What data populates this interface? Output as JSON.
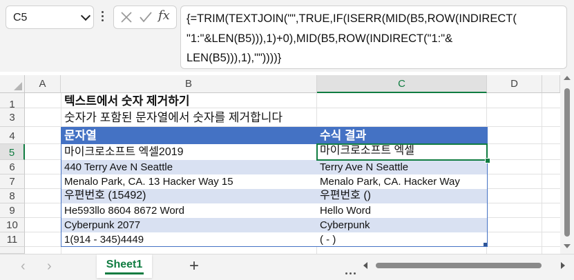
{
  "name_box": {
    "value": "C5"
  },
  "formula_bar": {
    "fx_label": "fx",
    "formula_lines": [
      "{=TRIM(TEXTJOIN(\"\",TRUE,IF(ISERR(MID(B5,ROW(INDIRECT(",
      "\"1:\"&LEN(B5))),1)+0),MID(B5,ROW(INDIRECT(\"1:\"&",
      "LEN(B5))),1),\"\"))))}"
    ]
  },
  "columns": [
    "A",
    "B",
    "C",
    "D"
  ],
  "active_column": "C",
  "rows": [
    "1",
    "3",
    "4",
    "5",
    "6",
    "7",
    "8",
    "9",
    "10",
    "11"
  ],
  "active_row": "5",
  "sheet": {
    "title": "텍스트에서 숫자 제거하기",
    "subtitle": "숫자가 포함된 문자열에서 숫자를 제거합니다",
    "table": {
      "headers": [
        "문자열",
        "수식 결과"
      ],
      "rows": [
        [
          "마이크로소프트 엑셀2019",
          "마이크로소프트 엑셀"
        ],
        [
          "440 Terry Ave N Seattle",
          "Terry Ave N Seattle"
        ],
        [
          "Menalo Park, CA. 13 Hacker Way 15",
          "Menalo Park, CA. Hacker Way"
        ],
        [
          "우편번호 (15492)",
          "우편번호 ()"
        ],
        [
          "He593llo 8604 8672 Word",
          "Hello Word"
        ],
        [
          "Cyberpunk 2077",
          "Cyberpunk"
        ],
        [
          "1(914 - 345)4449",
          "( - )"
        ]
      ]
    },
    "header_color": "#4472c4",
    "band_color": "#d9e1f2"
  },
  "tabs": {
    "active": "Sheet1",
    "add_label": "+"
  },
  "colors": {
    "accent": "#107c41"
  }
}
